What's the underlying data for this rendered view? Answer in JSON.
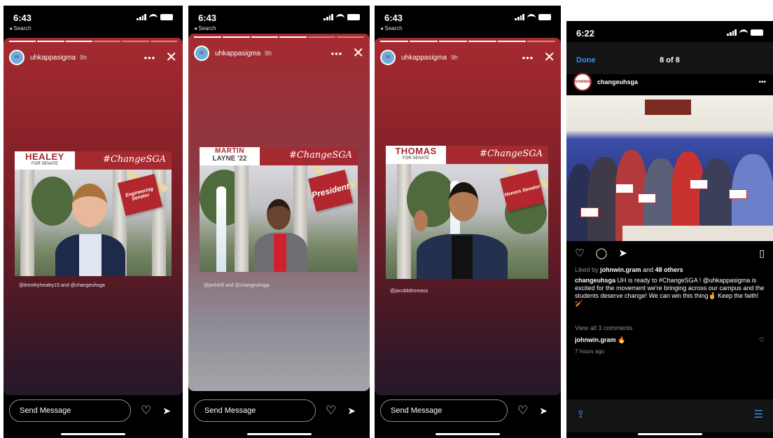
{
  "panels": [
    {
      "time": "6:43",
      "back_label": "◂ Search",
      "username": "uhkappasigma",
      "age": "9h",
      "name_line1": "HEALEY",
      "name_sub": "FOR SENATE",
      "hashtag": "#ChangeSGA",
      "tag_text": "Engineering Senator",
      "mention": "@timothyhealey15 and @changeuhsga",
      "placeholder": "Send Message"
    },
    {
      "time": "6:43",
      "back_label": "◂ Search",
      "username": "uhkappasigma",
      "age": "9h",
      "name_line1": "MARTIN",
      "name_line2": "LAYNE '22",
      "hashtag": "#ChangeSGA",
      "tag_text": "President",
      "mention": "@joshtrill and @changeuhsga",
      "placeholder": "Send Message"
    },
    {
      "time": "6:43",
      "back_label": "◂ Search",
      "username": "uhkappasigma",
      "age": "9h",
      "name_line1": "THOMAS",
      "name_sub": "FOR SENATE",
      "hashtag": "#ChangeSGA",
      "tag_text": "Honors Senator",
      "mention": "@jacobbthomass",
      "placeholder": "Send Message"
    }
  ],
  "feed": {
    "time": "6:22",
    "done_label": "Done",
    "counter": "8 of 8",
    "username": "changeuhsga",
    "liked_prefix": "Liked by",
    "liked_user": "johnwin.gram",
    "liked_suffix": "and",
    "liked_others": "48 others",
    "caption_user": "changeuhsga",
    "caption_text": "UH is ready to #ChangeSGA ! @uhkappasigma is excited for the movement we're bringing across our campus and the students deserve change! We can win this thing🤞 Keep the faith! 🏏",
    "view_comments": "View all 3 comments",
    "comment_user": "johnwin.gram",
    "comment_text": "🔥",
    "posted_ago": "7 hours ago"
  },
  "colors": {
    "story_red": "#a52a30",
    "ios_blue": "#3a8df0"
  },
  "icons": {
    "more": "more-icon",
    "close": "close-icon",
    "heart": "heart-icon",
    "send": "send-icon",
    "comment": "comment-icon",
    "bookmark": "bookmark-icon",
    "share": "share-icon",
    "list": "list-icon"
  }
}
